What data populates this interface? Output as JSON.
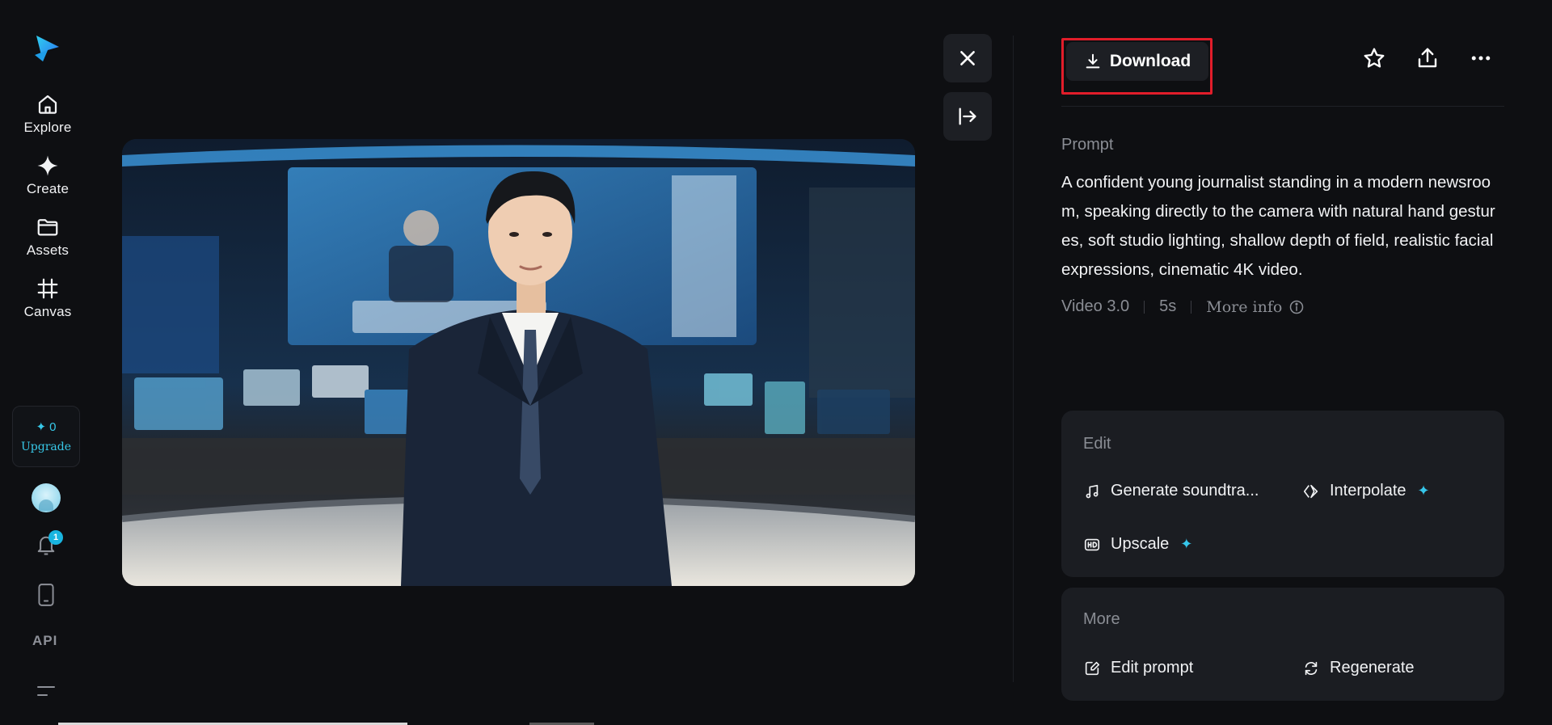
{
  "nav": {
    "items": [
      {
        "label": "Explore",
        "icon": "home-icon"
      },
      {
        "label": "Create",
        "icon": "sparkle-icon"
      },
      {
        "label": "Assets",
        "icon": "folder-icon"
      },
      {
        "label": "Canvas",
        "icon": "grid-icon"
      }
    ],
    "credits": "0",
    "upgrade_label": "Upgrade",
    "notification_count": "1",
    "api_label": "API"
  },
  "toolbar": {
    "download_label": "Download",
    "favorite_icon": "star-icon",
    "share_icon": "share-icon",
    "more_icon": "ellipsis-icon"
  },
  "prompt": {
    "label": "Prompt",
    "text": "A confident young journalist standing in a modern newsroom, speaking directly to the camera with natural hand gestures, soft studio lighting, shallow depth of field, realistic facial expressions, cinematic 4K video."
  },
  "meta": {
    "model": "Video 3.0",
    "duration": "5s",
    "more_info": "More info"
  },
  "edit": {
    "title": "Edit",
    "generate_soundtrack": "Generate soundtra...",
    "interpolate": "Interpolate",
    "upscale": "Upscale"
  },
  "more": {
    "title": "More",
    "edit_prompt": "Edit prompt",
    "regenerate": "Regenerate"
  },
  "colors": {
    "accent": "#36c6ea",
    "highlight": "#e11d2a",
    "background": "#0e0f12",
    "card": "#1b1d22"
  }
}
